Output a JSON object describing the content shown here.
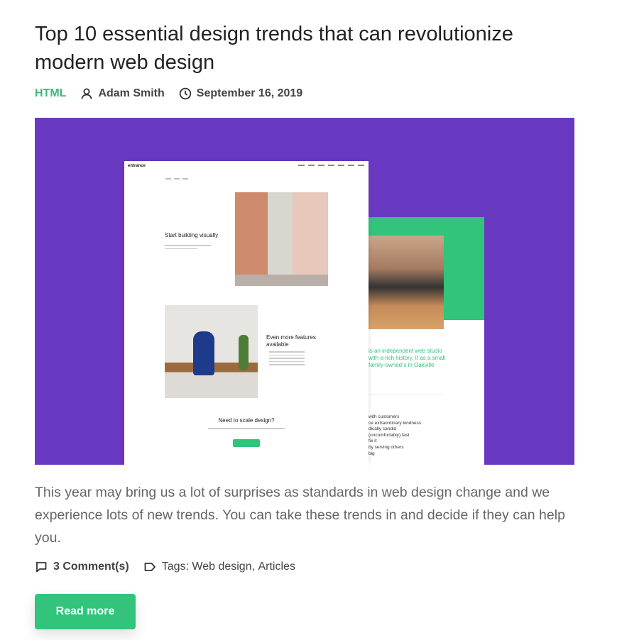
{
  "post": {
    "title": "Top 10 essential design trends that can revolutionize modern web design",
    "category": "HTML",
    "author": "Adam Smith",
    "date": "September 16, 2019",
    "excerpt": "This year may bring us a lot of surprises as standards in web design change and we experience lots of new trends. You can take these trends in and decide if they can help you.",
    "comments_count": "3 Comment(s)",
    "tags_label": "Tags:",
    "tags": [
      "Web design",
      "Articles"
    ],
    "read_more_label": "Read more"
  },
  "hero_image": {
    "background_color": "#6a39c2",
    "logo": "entrance",
    "heading_1": "Start building visually",
    "heading_2": "Even more features available",
    "heading_3": "Need to scale design?",
    "back_green_text": "is an independent web studio with a rich history. It as a small family-owned s in Oakville",
    "back_list": [
      "with customers",
      "ce extraordinary kindness",
      "dically candid",
      "(uncomfortably) fast",
      "fix it",
      "by serving others",
      "big"
    ]
  },
  "colors": {
    "accent": "#31c47a",
    "category": "#3cb878",
    "text": "#222222",
    "muted": "#666666"
  }
}
